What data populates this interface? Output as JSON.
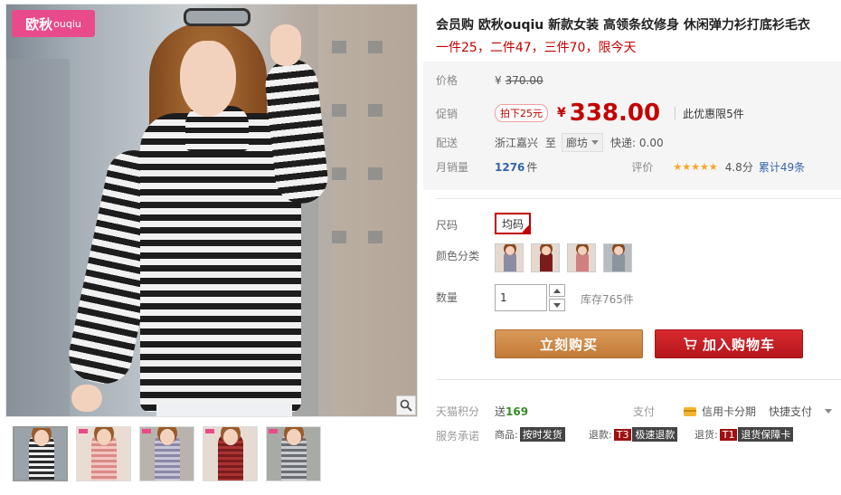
{
  "brand": {
    "logo_text": "欧秋",
    "logo_sub": "ouqiu",
    "color": "#e94b8a"
  },
  "product": {
    "title": "会员购 欧秋ouqiu 新款女装 高领条纹修身 休闲弹力衫打底衫毛衣",
    "promo": "一件25，二件47，三件70，限今天"
  },
  "price": {
    "label": "价格",
    "yen": "¥",
    "original": "370.00"
  },
  "promotion": {
    "label": "促销",
    "tag": "拍下25元",
    "yen": "¥",
    "value": "338.00",
    "limit": "此优惠限5件"
  },
  "shipping": {
    "label": "配送",
    "from": "浙江嘉兴",
    "to_label": "至",
    "destination": "廊坊",
    "fee": "快递: 0.00"
  },
  "sales": {
    "label": "月销量",
    "count": "1276",
    "unit": "件",
    "rating_label": "评价",
    "stars": "★★★★★",
    "score": "4.8分",
    "reviews": "累计49条"
  },
  "options": {
    "size_label": "尺码",
    "size_value": "均码",
    "color_label": "颜色分类",
    "colors": [
      "#8a8ea0",
      "#7a1c1c",
      "#d08080",
      "#8c94a0"
    ],
    "qty_label": "数量",
    "qty_value": "1",
    "stock": "库存765件"
  },
  "actions": {
    "buy": "立刻购买",
    "cart": "加入购物车"
  },
  "points": {
    "label": "天猫积分",
    "text": "送",
    "value": "169"
  },
  "payment": {
    "label": "支付",
    "credit": "信用卡分期",
    "quick": "快捷支付"
  },
  "service": {
    "label": "服务承诺",
    "item1_prefix": "商品:",
    "item1_badge": "按时发货",
    "item2_prefix": "退款:",
    "item2_code": "T3",
    "item2_badge": "极速退款",
    "item3_prefix": "退货:",
    "item3_code": "T1",
    "item3_badge": "退货保障卡"
  },
  "thumbnails": [
    {
      "bg": "#9aa3aa",
      "top": "#2a2a2a"
    },
    {
      "bg": "#e9dcd2",
      "top": "#d98a86"
    },
    {
      "bg": "#b8b3ad",
      "top": "#8a88a8"
    },
    {
      "bg": "#e6dbd3",
      "top": "#7a1c1c"
    },
    {
      "bg": "#a8aaa6",
      "top": "#6a6e74"
    }
  ],
  "icons": [
    "zoom-icon",
    "cart-icon",
    "card-icon",
    "chevron-down-icon"
  ]
}
